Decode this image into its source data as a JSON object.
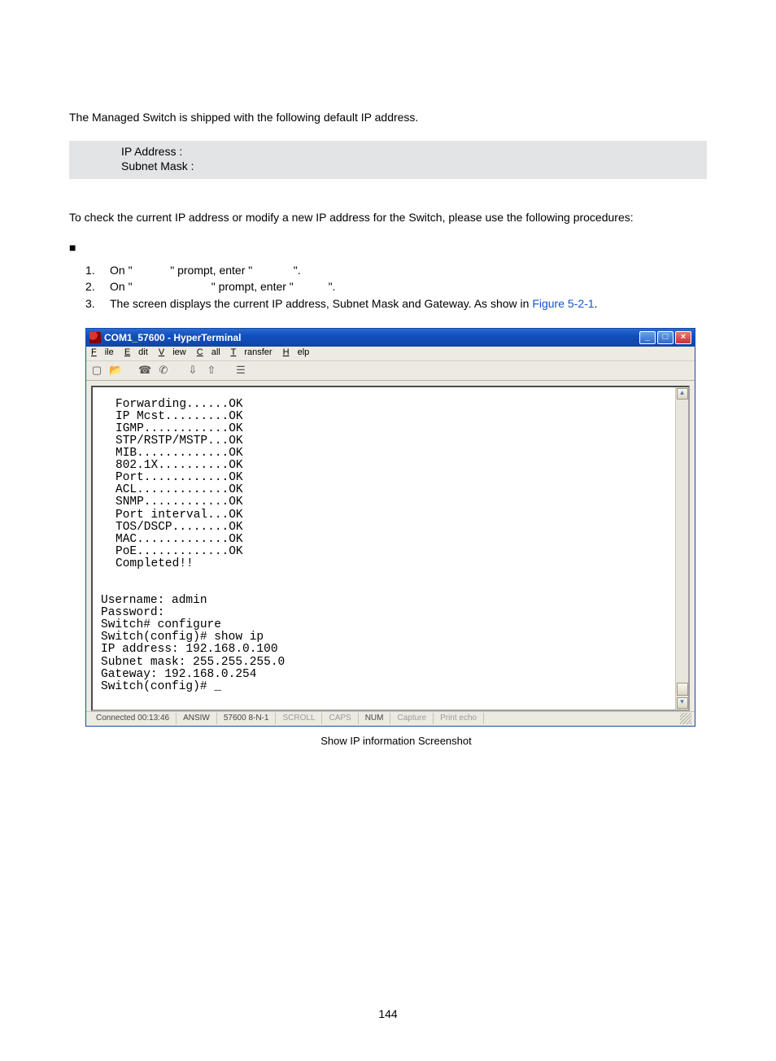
{
  "text": {
    "intro": "The Managed Switch is shipped with the following default IP address.",
    "info_ip": "IP Address :",
    "info_mask": "Subnet Mask :",
    "proc_lead": "To check the current IP address or modify a new IP address for the Switch, please use the following procedures:",
    "bullet": "■",
    "step1_a": "On \"",
    "step1_b": "\" prompt, enter \"",
    "step1_c": "\".",
    "step2_a": "On \"",
    "step2_b": "\" prompt, enter \"",
    "step2_c": "\".",
    "step3_a": "The screen displays the current IP address, Subnet Mask and Gateway. As show in ",
    "step3_link": "Figure 5-2-1",
    "step3_b": ".",
    "caption": "Show IP information Screenshot",
    "n1": "1.",
    "n2": "2.",
    "n3": "3.",
    "page_num": "144"
  },
  "hyperterminal": {
    "title": "COM1_57600 - HyperTerminal",
    "menu": {
      "file": "File",
      "edit": "Edit",
      "view": "View",
      "call": "Call",
      "transfer": "Transfer",
      "help": "Help"
    },
    "status": {
      "connected": "Connected 00:13:46",
      "emu": "ANSIW",
      "line": "57600 8-N-1",
      "scroll": "SCROLL",
      "caps": "CAPS",
      "num": "NUM",
      "capture": "Capture",
      "echo": "Print echo"
    },
    "boot_lines": [
      "Forwarding......OK",
      "IP Mcst.........OK",
      "IGMP............OK",
      "STP/RSTP/MSTP...OK",
      "MIB.............OK",
      "802.1X..........OK",
      "Port............OK",
      "ACL.............OK",
      "SNMP............OK",
      "Port interval...OK",
      "TOS/DSCP........OK",
      "MAC.............OK",
      "PoE.............OK",
      "Completed!!"
    ],
    "session_lines": [
      "Username: admin",
      "Password:",
      "Switch# configure",
      "Switch(config)# show ip",
      "IP address: 192.168.0.100",
      "Subnet mask: 255.255.255.0",
      "Gateway: 192.168.0.254",
      "Switch(config)# _"
    ]
  }
}
